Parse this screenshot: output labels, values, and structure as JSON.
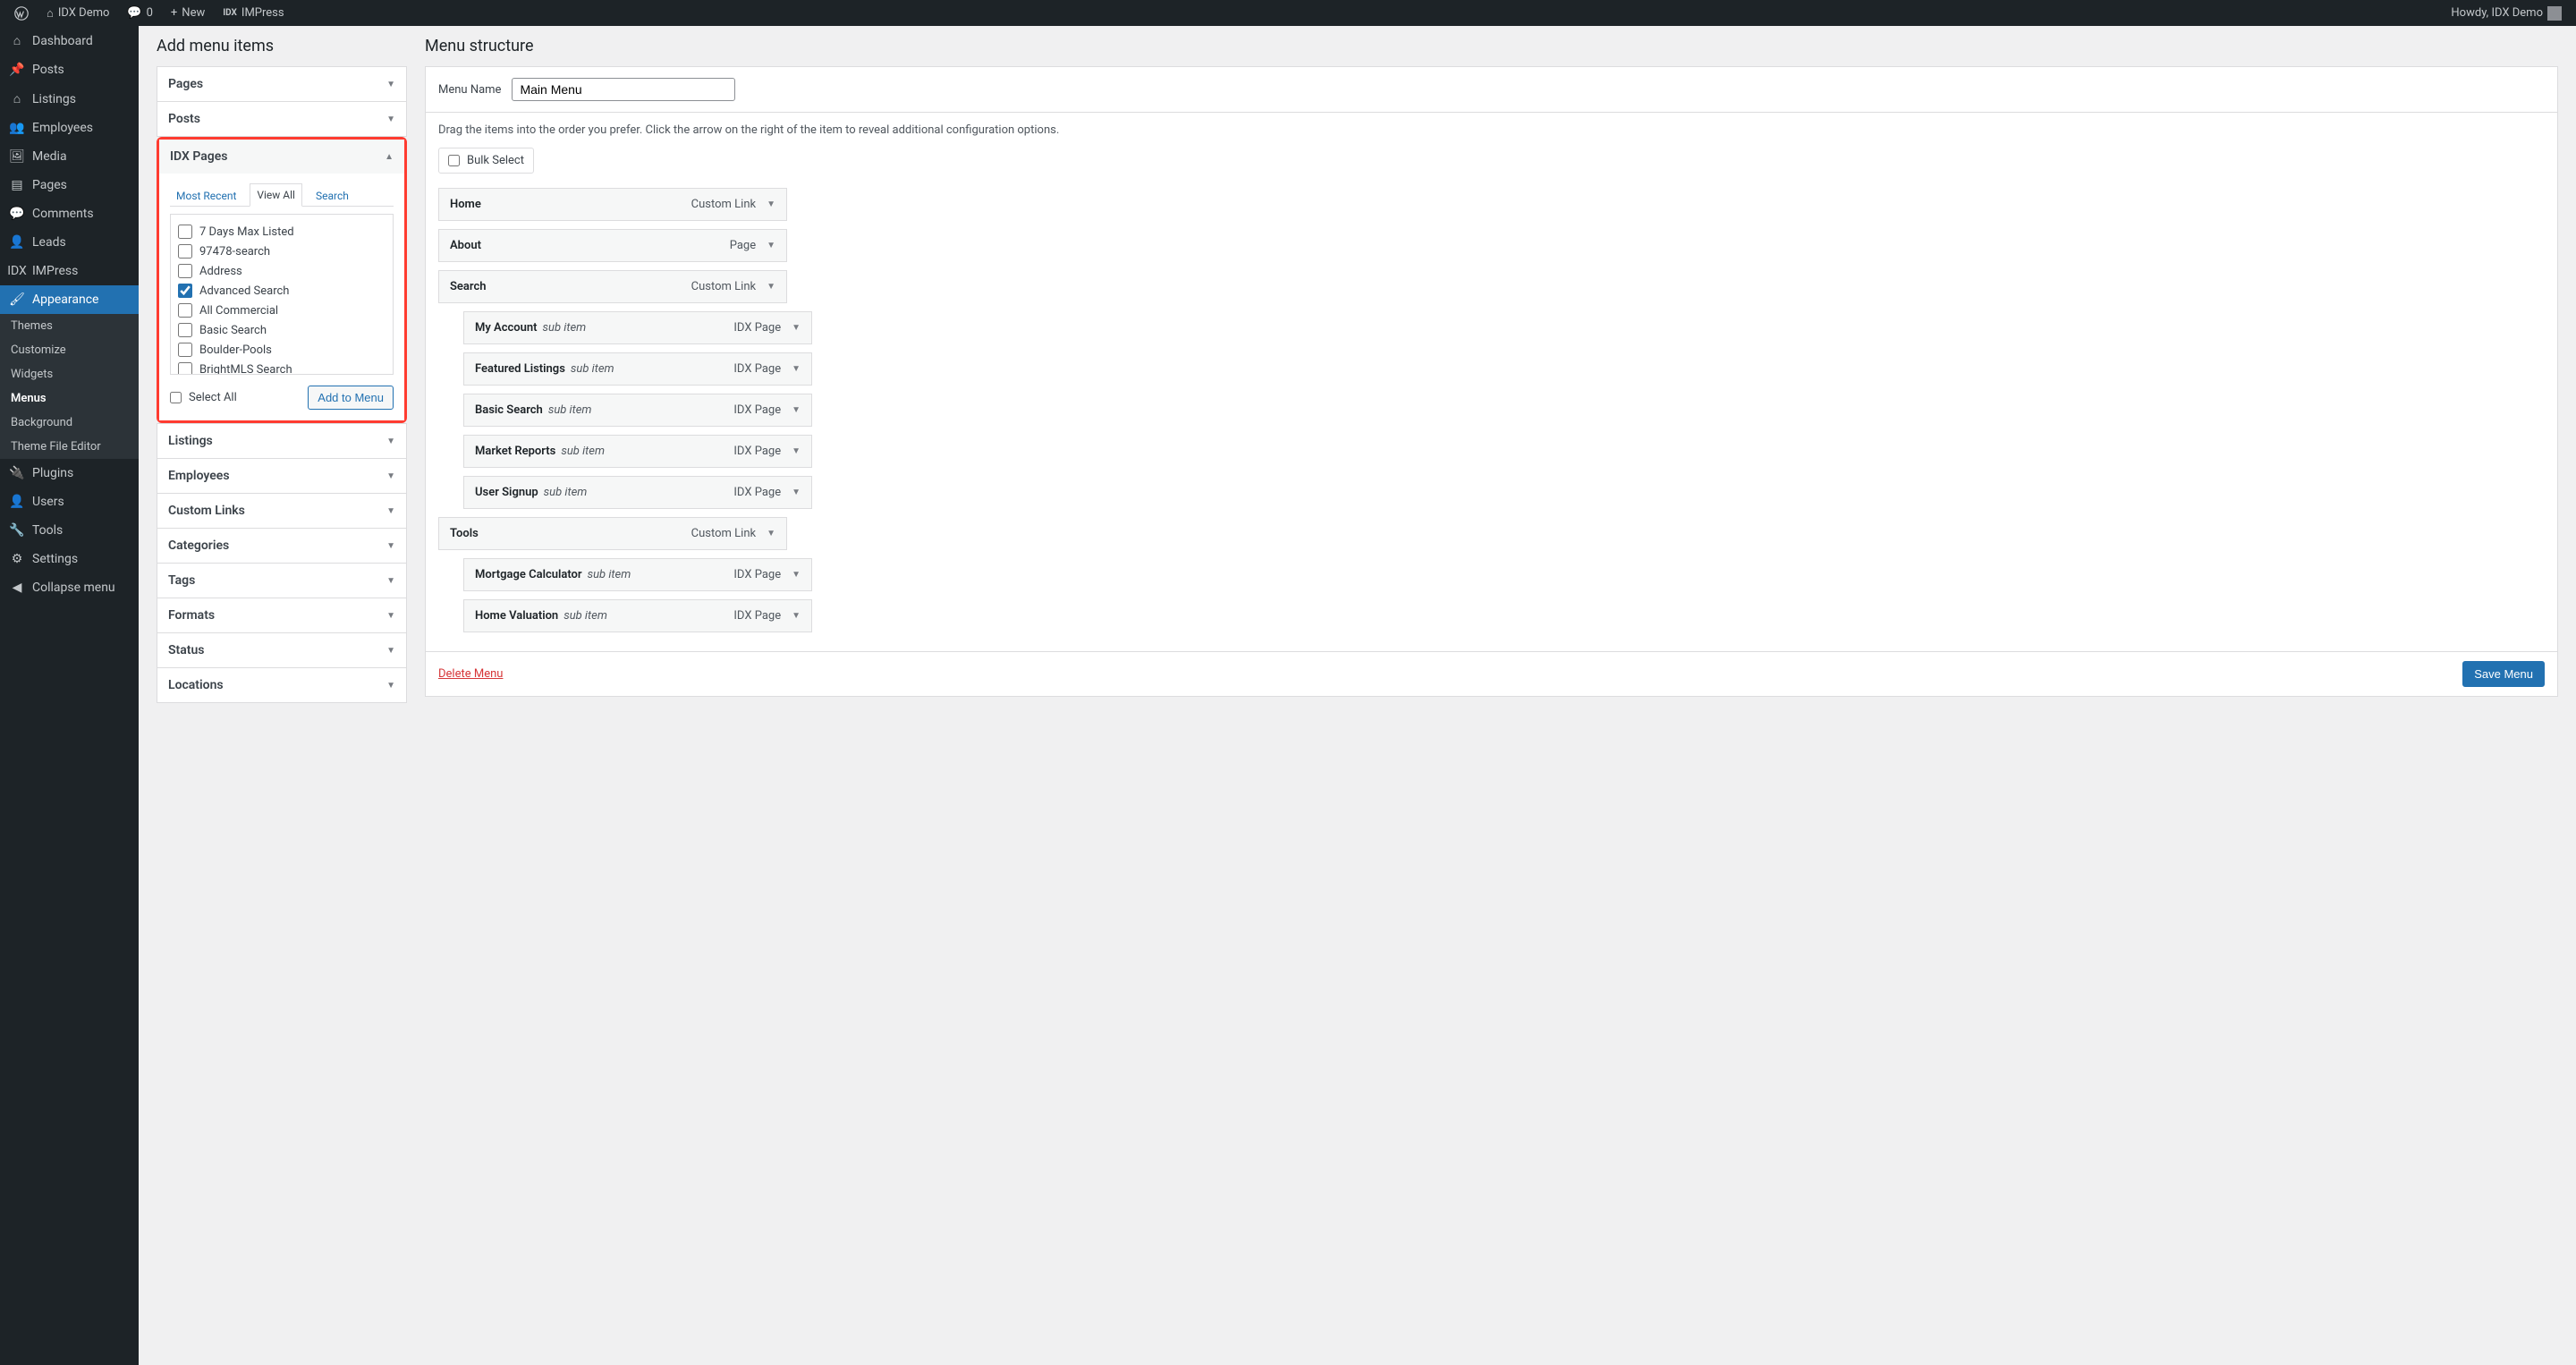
{
  "adminbar": {
    "site_name": "IDX Demo",
    "comments": "0",
    "new_label": "New",
    "impress_label": "IMPress",
    "howdy": "Howdy, IDX Demo"
  },
  "sidebar": {
    "items": [
      {
        "label": "Dashboard",
        "icon": "⌂"
      },
      {
        "label": "Posts",
        "icon": "📌"
      },
      {
        "label": "Listings",
        "icon": "⌂"
      },
      {
        "label": "Employees",
        "icon": "👥"
      },
      {
        "label": "Media",
        "icon": "🖼"
      },
      {
        "label": "Pages",
        "icon": "▤"
      },
      {
        "label": "Comments",
        "icon": "💬"
      },
      {
        "label": "Leads",
        "icon": "👤"
      },
      {
        "label": "IMPress",
        "icon": "IDX"
      }
    ],
    "appearance_label": "Appearance",
    "sub": [
      "Themes",
      "Customize",
      "Widgets",
      "Menus",
      "Background",
      "Theme File Editor"
    ],
    "footer_items": [
      {
        "label": "Plugins",
        "icon": "🔌"
      },
      {
        "label": "Users",
        "icon": "👤"
      },
      {
        "label": "Tools",
        "icon": "🔧"
      },
      {
        "label": "Settings",
        "icon": "⚙"
      }
    ],
    "collapse": "Collapse menu"
  },
  "add_menu": {
    "title": "Add menu items",
    "panels": [
      "Pages",
      "Posts"
    ],
    "idx_label": "IDX Pages",
    "tabs": {
      "recent": "Most Recent",
      "view_all": "View All",
      "search": "Search"
    },
    "items": [
      {
        "label": "7 Days Max Listed",
        "checked": false
      },
      {
        "label": "97478-search",
        "checked": false
      },
      {
        "label": "Address",
        "checked": false
      },
      {
        "label": "Advanced Search",
        "checked": true
      },
      {
        "label": "All Commercial",
        "checked": false
      },
      {
        "label": "Basic Search",
        "checked": false
      },
      {
        "label": "Boulder-Pools",
        "checked": false
      },
      {
        "label": "BrightMLS Search",
        "checked": false
      }
    ],
    "select_all": "Select All",
    "add_btn": "Add to Menu",
    "panels_after": [
      "Listings",
      "Employees",
      "Custom Links",
      "Categories",
      "Tags",
      "Formats",
      "Status",
      "Locations"
    ]
  },
  "structure": {
    "title": "Menu structure",
    "name_label": "Menu Name",
    "name_value": "Main Menu",
    "hint": "Drag the items into the order you prefer. Click the arrow on the right of the item to reveal additional configuration options.",
    "bulk_label": "Bulk Select",
    "items": [
      {
        "title": "Home",
        "type": "Custom Link",
        "sub": false
      },
      {
        "title": "About",
        "type": "Page",
        "sub": false
      },
      {
        "title": "Search",
        "type": "Custom Link",
        "sub": false
      },
      {
        "title": "My Account",
        "type": "IDX Page",
        "sub": true
      },
      {
        "title": "Featured Listings",
        "type": "IDX Page",
        "sub": true
      },
      {
        "title": "Basic Search",
        "type": "IDX Page",
        "sub": true
      },
      {
        "title": "Market Reports",
        "type": "IDX Page",
        "sub": true
      },
      {
        "title": "User Signup",
        "type": "IDX Page",
        "sub": true
      },
      {
        "title": "Tools",
        "type": "Custom Link",
        "sub": false
      },
      {
        "title": "Mortgage Calculator",
        "type": "IDX Page",
        "sub": true
      },
      {
        "title": "Home Valuation",
        "type": "IDX Page",
        "sub": true
      }
    ],
    "sub_item_label": "sub item",
    "delete": "Delete Menu",
    "save": "Save Menu"
  }
}
